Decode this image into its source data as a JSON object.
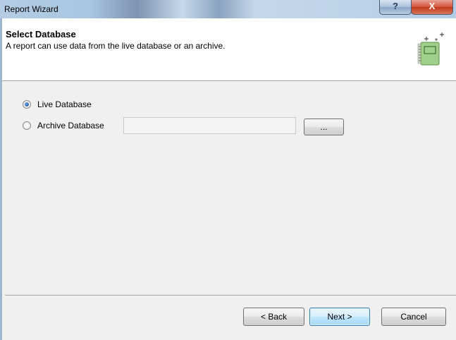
{
  "window": {
    "title": "Report Wizard",
    "help_label": "?",
    "close_label": "X"
  },
  "header": {
    "title": "Select Database",
    "description": "A report can use data from the live database or an archive.",
    "icon": "wizard-report-icon"
  },
  "options": {
    "live_label": "Live Database",
    "archive_label": "Archive Database",
    "selected": "Live Database",
    "archive_path_value": "",
    "browse_label": "..."
  },
  "footer": {
    "back_label": "< Back",
    "next_label": "Next >",
    "cancel_label": "Cancel"
  },
  "colors": {
    "title_bar": "#b4cde4",
    "header_bg": "#ffffff",
    "body_bg": "#f0f0f0",
    "default_button": "#bee6fd",
    "close_button": "#c1381c"
  }
}
